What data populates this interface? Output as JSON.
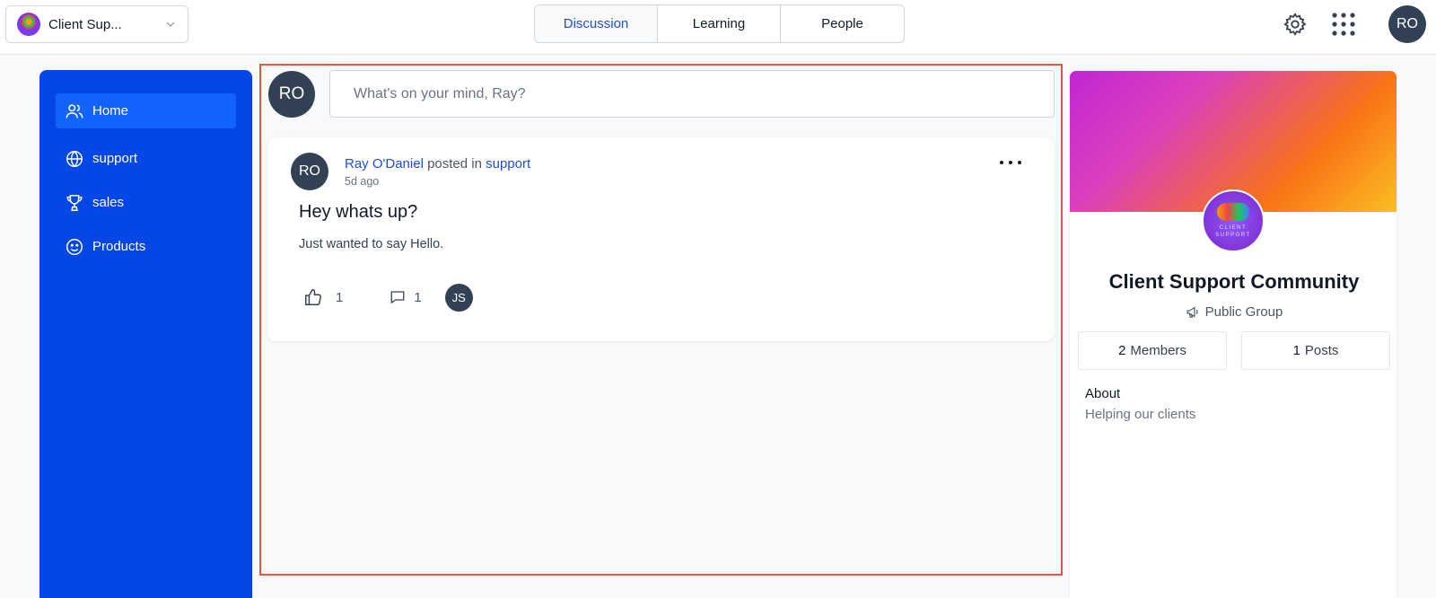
{
  "header": {
    "group_switcher": {
      "name": "Client Sup..."
    },
    "tabs": [
      {
        "label": "Discussion",
        "active": true
      },
      {
        "label": "Learning",
        "active": false
      },
      {
        "label": "People",
        "active": false
      }
    ],
    "user_initials": "RO"
  },
  "sidebar": {
    "items": [
      {
        "label": "Home",
        "icon": "users-icon",
        "active": true
      },
      {
        "label": "support",
        "icon": "globe-icon",
        "active": false
      },
      {
        "label": "sales",
        "icon": "trophy-icon",
        "active": false
      },
      {
        "label": "Products",
        "icon": "smiley-icon",
        "active": false
      }
    ]
  },
  "composer": {
    "avatar_initials": "RO",
    "placeholder": "What's on your mind, Ray?"
  },
  "post": {
    "author_initials": "RO",
    "author": "Ray O'Daniel",
    "posted_in_text": " posted in ",
    "channel": "support",
    "time": "5d ago",
    "title": "Hey whats up?",
    "body": "Just wanted to say Hello.",
    "likes": "1",
    "comments": "1",
    "commenter_initials": "JS"
  },
  "community": {
    "name": "Client Support Community",
    "type": "Public Group",
    "logo_text_1": "CLIENT",
    "logo_text_2": "SUPPORT",
    "members_count": "2",
    "members_label": "Members",
    "posts_count": "1",
    "posts_label": "Posts",
    "about_heading": "About",
    "about_text": "Helping our clients"
  },
  "colors": {
    "sidebar_bg": "#0447e6",
    "sidebar_active": "#1363ff",
    "link": "#1d4ed8",
    "avatar_bg": "#334155",
    "highlight_frame": "#e8553e"
  }
}
